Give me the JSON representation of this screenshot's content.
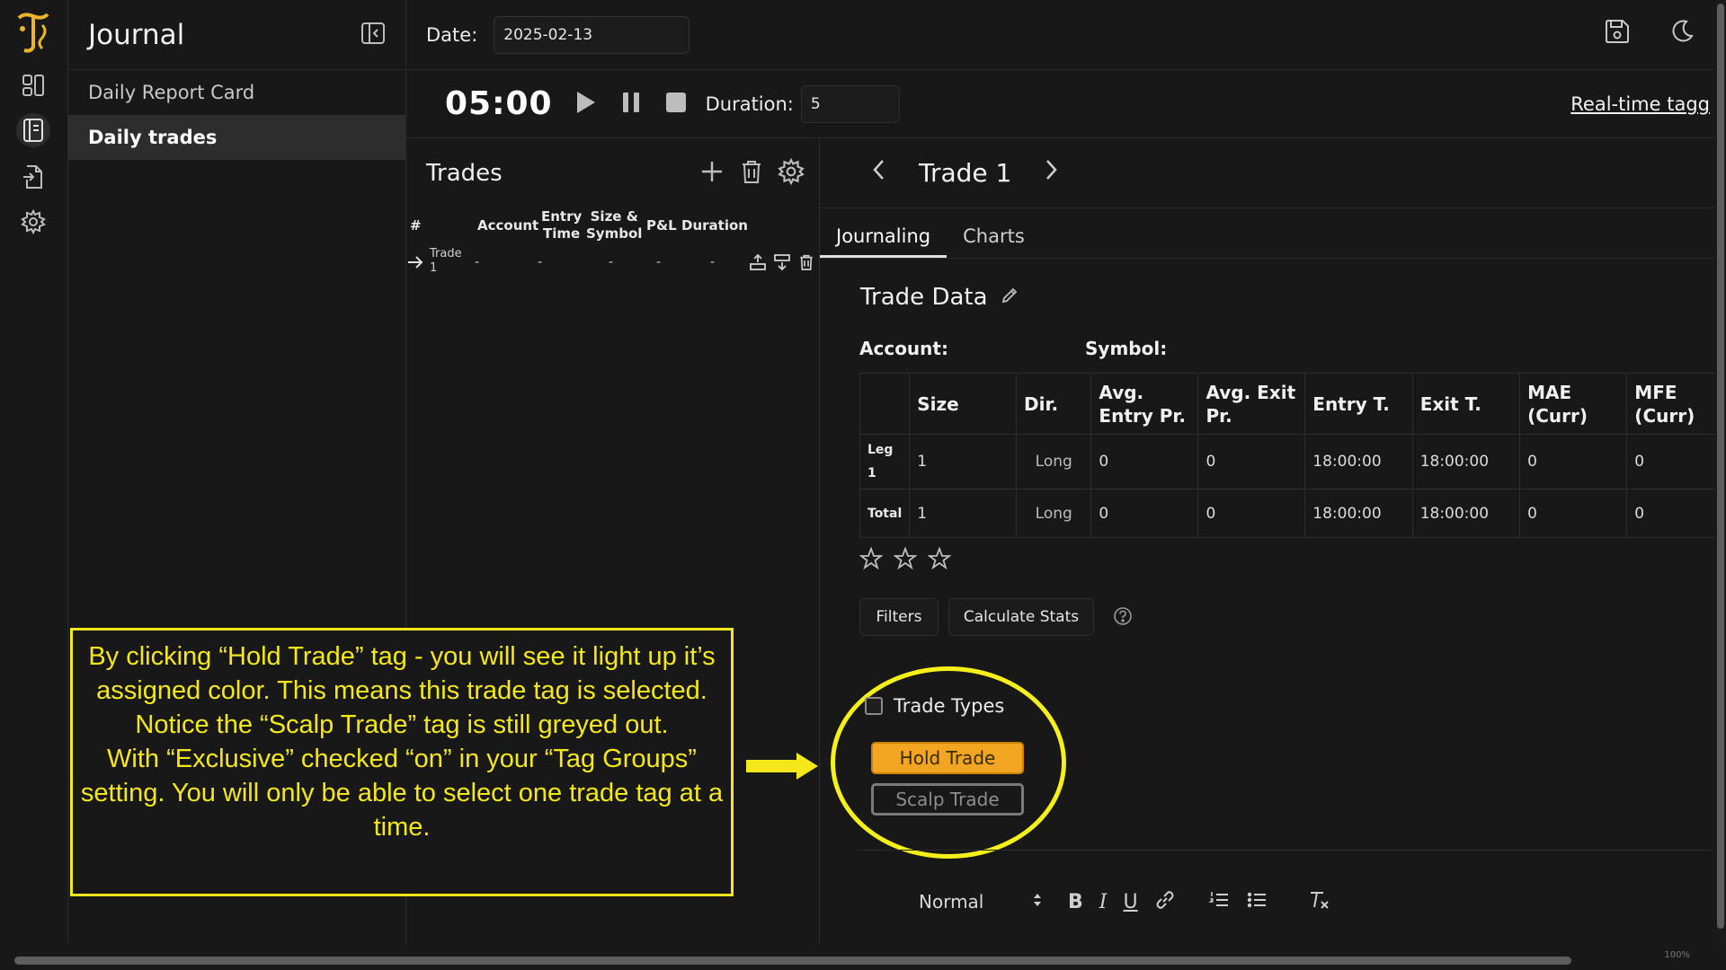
{
  "sidebar": {
    "title": "Journal",
    "items": [
      {
        "label": "Daily Report Card",
        "active": false
      },
      {
        "label": "Daily trades",
        "active": true
      }
    ]
  },
  "header": {
    "date_label": "Date:",
    "date_value": "2025-02-13"
  },
  "timer": {
    "time": "05:00",
    "duration_label": "Duration:",
    "duration_value": "5",
    "realtime_link": "Real-time tagg"
  },
  "trades": {
    "title": "Trades",
    "columns": [
      "#",
      "Account",
      "Entry\nTime",
      "Size &\nSymbol",
      "P&L",
      "Duration"
    ],
    "rows": [
      {
        "name": "Trade\n1",
        "account": "-",
        "entry_time": "-",
        "size_symbol": "-",
        "pnl": "-",
        "duration": "-"
      }
    ]
  },
  "detail": {
    "trade_title": "Trade 1",
    "tabs": [
      "Journaling",
      "Charts"
    ],
    "active_tab": "Journaling",
    "section_title": "Trade Data",
    "account_label": "Account:",
    "symbol_label": "Symbol:",
    "table": {
      "headers": [
        "",
        "Size",
        "Dir.",
        "Avg. Entry Pr.",
        "Avg. Exit Pr.",
        "Entry T.",
        "Exit T.",
        "MAE (Curr)",
        "MFE (Curr)"
      ],
      "rows": [
        {
          "label": "Leg 1",
          "size": "1",
          "dir": "Long",
          "avg_entry": "0",
          "avg_exit": "0",
          "entry_t": "18:00:00",
          "exit_t": "18:00:00",
          "mae": "0",
          "mfe": "0"
        },
        {
          "label": "Total",
          "size": "1",
          "dir": "Long",
          "avg_entry": "0",
          "avg_exit": "0",
          "entry_t": "18:00:00",
          "exit_t": "18:00:00",
          "mae": "0",
          "mfe": "0"
        }
      ]
    },
    "rating": 0,
    "filters_label": "Filters",
    "calc_label": "Calculate Stats",
    "tag_group": {
      "label": "Trade Types",
      "tags": [
        {
          "label": "Hold Trade",
          "selected": true,
          "color": "#f1a521"
        },
        {
          "label": "Scalp Trade",
          "selected": false,
          "color": "#7a7a7a"
        }
      ]
    },
    "editor": {
      "format": "Normal"
    }
  },
  "annotation": {
    "text": "By clicking “Hold Trade” tag - you will see it light up it’s assigned color. This means this trade tag is selected. Notice the “Scalp Trade” tag is still greyed out.\nWith “Exclusive” checked “on” in your “Tag Groups” setting. You will only be able to select one trade tag at a time.",
    "color": "#f5e81a"
  },
  "scroll": {
    "zoom_text": "100%"
  }
}
